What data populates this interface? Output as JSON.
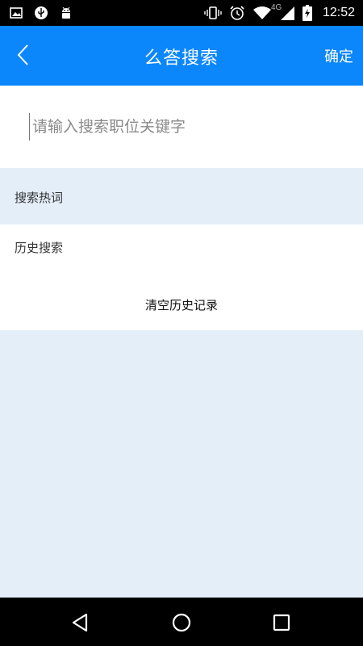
{
  "status_bar": {
    "time": "12:52",
    "network": "4G",
    "left_icons": [
      "image-icon",
      "usb-icon",
      "android-icon"
    ],
    "right_icons": [
      "vibrate-icon",
      "alarm-icon",
      "wifi-icon",
      "signal-icon",
      "battery-charging-icon"
    ]
  },
  "header": {
    "title": "么答搜索",
    "confirm_label": "确定",
    "back_icon": "chevron-left-icon",
    "background": "#0b86fb"
  },
  "search": {
    "placeholder": "请输入搜索职位关键字",
    "value": ""
  },
  "hot_keywords": {
    "label": "搜索热词"
  },
  "history": {
    "label": "历史搜索",
    "clear_label": "清空历史记录"
  },
  "nav_bar": {
    "buttons": [
      "back-triangle-icon",
      "home-circle-icon",
      "recents-square-icon"
    ]
  },
  "colors": {
    "accent": "#0b86fb",
    "page_background": "#e3eef9"
  }
}
